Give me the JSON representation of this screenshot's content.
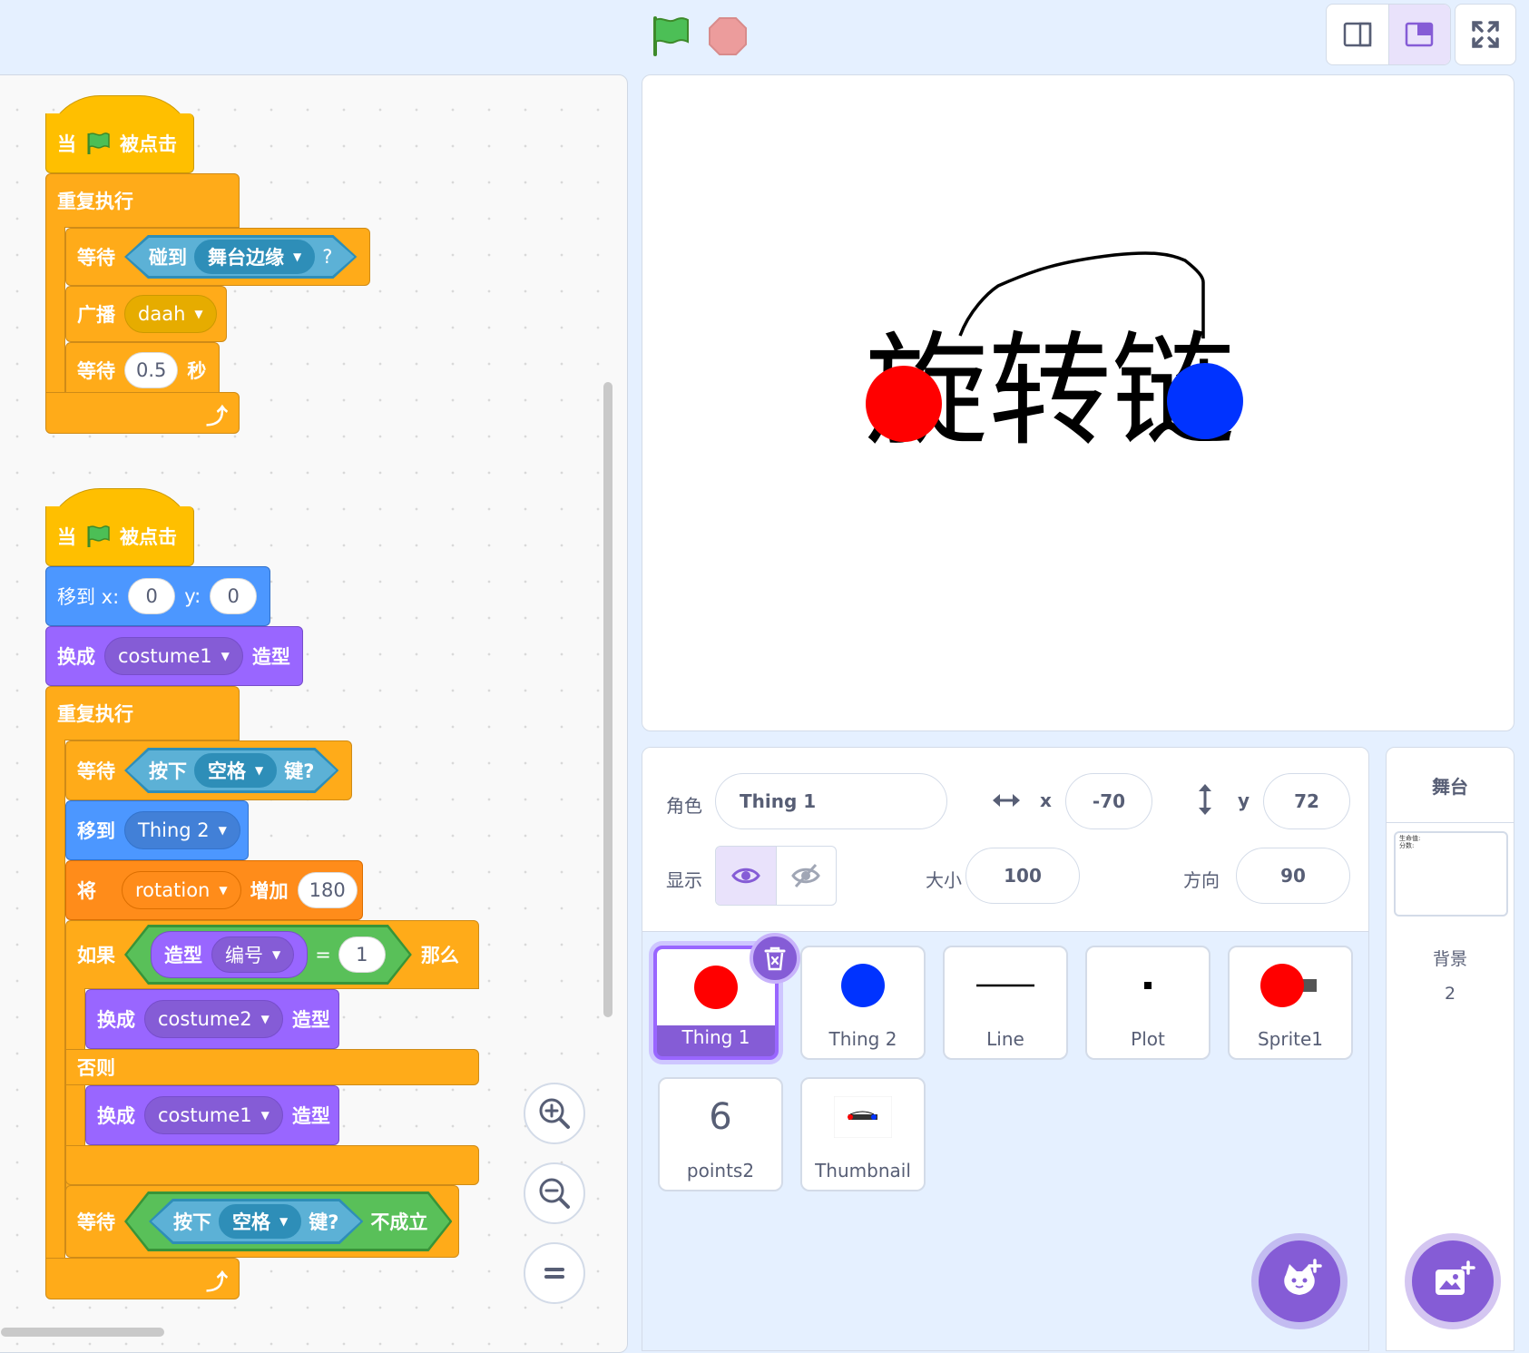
{
  "colors": {
    "events": "#ffbf00",
    "control": "#ffab19",
    "motion": "#4c97ff",
    "looks": "#9966ff",
    "variables": "#ff8c1a",
    "sensing": "#5cb1d6",
    "operators": "#59c059",
    "accent": "#855cd6",
    "workspace_bg": "#e5f0ff"
  },
  "toolbar": {
    "green_flag_icon": "green-flag-icon",
    "stop_icon": "stop-icon"
  },
  "script1": {
    "hat": {
      "when": "当",
      "clicked": "被点击"
    },
    "forever": "重复执行",
    "wait_until": {
      "label": "等待",
      "touching": "碰到",
      "target": "舞台边缘",
      "q": "?"
    },
    "broadcast": {
      "label": "广播",
      "message": "daah"
    },
    "wait": {
      "label": "等待",
      "value": "0.5",
      "unit": "秒"
    }
  },
  "script2": {
    "hat": {
      "when": "当",
      "clicked": "被点击"
    },
    "goto_xy": {
      "label": "移到 x:",
      "x": "0",
      "ylabel": "y:",
      "y": "0"
    },
    "switch1": {
      "label": "换成",
      "costume": "costume1",
      "suffix": "造型"
    },
    "forever": "重复执行",
    "wait_key": {
      "label": "等待",
      "press": "按下",
      "key": "空格",
      "suffix": "键?"
    },
    "goto": {
      "label": "移到",
      "target": "Thing 2"
    },
    "change_var": {
      "label": "将",
      "var": "rotation",
      "by": "增加",
      "value": "180"
    },
    "if_else": {
      "if": "如果",
      "costume": "造型",
      "number": "编号",
      "eq": "=",
      "value": "1",
      "then": "那么",
      "switch_a": {
        "label": "换成",
        "costume": "costume2",
        "suffix": "造型"
      },
      "else": "否则",
      "switch_b": {
        "label": "换成",
        "costume": "costume1",
        "suffix": "造型"
      }
    },
    "wait_not": {
      "label": "等待",
      "press": "按下",
      "key": "空格",
      "suffix": "键?",
      "not": "不成立"
    }
  },
  "stage": {
    "title_text": "旋转链"
  },
  "sprite_info": {
    "sprite_label": "角色",
    "sprite_name": "Thing 1",
    "x_label": "x",
    "x": "-70",
    "y_label": "y",
    "y": "72",
    "show_label": "显示",
    "size_label": "大小",
    "size": "100",
    "direction_label": "方向",
    "direction": "90"
  },
  "sprites": [
    {
      "name": "Thing 1",
      "selected": true
    },
    {
      "name": "Thing 2"
    },
    {
      "name": "Line"
    },
    {
      "name": "Plot"
    },
    {
      "name": "Sprite1"
    },
    {
      "name": "points2",
      "number": "6"
    },
    {
      "name": "Thumbnail"
    }
  ],
  "stage_pane": {
    "title": "舞台",
    "backdrops_label": "背景",
    "backdrops_count": "2",
    "thumb_line1": "生命值:",
    "thumb_line2": "分数:"
  }
}
